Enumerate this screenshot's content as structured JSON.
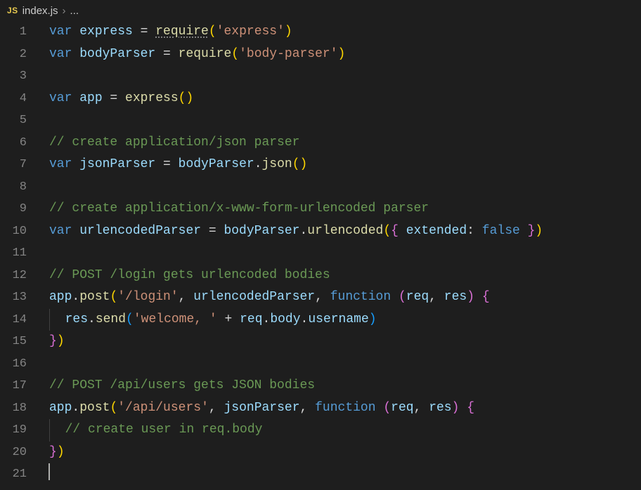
{
  "breadcrumb": {
    "icon_label": "JS",
    "filename": "index.js",
    "separator": "›",
    "path_rest": "..."
  },
  "lines": {
    "count": 21,
    "c1": [
      {
        "t": "var",
        "c": "kw"
      },
      {
        "t": " "
      },
      {
        "t": "express",
        "c": "var"
      },
      {
        "t": " = "
      },
      {
        "t": "require",
        "c": "fn",
        "hint": true
      },
      {
        "t": "(",
        "c": "brace-y"
      },
      {
        "t": "'express'",
        "c": "str"
      },
      {
        "t": ")",
        "c": "brace-y"
      }
    ],
    "c2": [
      {
        "t": "var",
        "c": "kw"
      },
      {
        "t": " "
      },
      {
        "t": "bodyParser",
        "c": "var"
      },
      {
        "t": " = "
      },
      {
        "t": "require",
        "c": "fn"
      },
      {
        "t": "(",
        "c": "brace-y"
      },
      {
        "t": "'body-parser'",
        "c": "str"
      },
      {
        "t": ")",
        "c": "brace-y"
      }
    ],
    "c3": [],
    "c4": [
      {
        "t": "var",
        "c": "kw"
      },
      {
        "t": " "
      },
      {
        "t": "app",
        "c": "var"
      },
      {
        "t": " = "
      },
      {
        "t": "express",
        "c": "fn"
      },
      {
        "t": "()",
        "c": "brace-y"
      }
    ],
    "c5": [],
    "c6": [
      {
        "t": "// create application/json parser",
        "c": "com"
      }
    ],
    "c7": [
      {
        "t": "var",
        "c": "kw"
      },
      {
        "t": " "
      },
      {
        "t": "jsonParser",
        "c": "var"
      },
      {
        "t": " = "
      },
      {
        "t": "bodyParser",
        "c": "var"
      },
      {
        "t": "."
      },
      {
        "t": "json",
        "c": "fn"
      },
      {
        "t": "()",
        "c": "brace-y"
      }
    ],
    "c8": [],
    "c9": [
      {
        "t": "// create application/x-www-form-urlencoded parser",
        "c": "com"
      }
    ],
    "c10": [
      {
        "t": "var",
        "c": "kw"
      },
      {
        "t": " "
      },
      {
        "t": "urlencodedParser",
        "c": "var"
      },
      {
        "t": " = "
      },
      {
        "t": "bodyParser",
        "c": "var"
      },
      {
        "t": "."
      },
      {
        "t": "urlencoded",
        "c": "fn"
      },
      {
        "t": "(",
        "c": "brace-y"
      },
      {
        "t": "{ ",
        "c": "brace-p"
      },
      {
        "t": "extended",
        "c": "var"
      },
      {
        "t": ":",
        "c": "pun"
      },
      {
        "t": " "
      },
      {
        "t": "false",
        "c": "bool"
      },
      {
        "t": " }",
        "c": "brace-p"
      },
      {
        "t": ")",
        "c": "brace-y"
      }
    ],
    "c11": [],
    "c12": [
      {
        "t": "// POST /login gets urlencoded bodies",
        "c": "com"
      }
    ],
    "c13": [
      {
        "t": "app",
        "c": "var"
      },
      {
        "t": "."
      },
      {
        "t": "post",
        "c": "fn"
      },
      {
        "t": "(",
        "c": "brace-y"
      },
      {
        "t": "'/login'",
        "c": "str"
      },
      {
        "t": ", "
      },
      {
        "t": "urlencodedParser",
        "c": "var"
      },
      {
        "t": ", "
      },
      {
        "t": "function",
        "c": "kw"
      },
      {
        "t": " "
      },
      {
        "t": "(",
        "c": "brace-p"
      },
      {
        "t": "req",
        "c": "var"
      },
      {
        "t": ", "
      },
      {
        "t": "res",
        "c": "var"
      },
      {
        "t": ")",
        "c": "brace-p"
      },
      {
        "t": " "
      },
      {
        "t": "{",
        "c": "brace-p"
      }
    ],
    "c14": [
      {
        "t": "  ",
        "guide": true
      },
      {
        "t": "res",
        "c": "var"
      },
      {
        "t": "."
      },
      {
        "t": "send",
        "c": "fn"
      },
      {
        "t": "(",
        "c": "brace-b"
      },
      {
        "t": "'welcome, '",
        "c": "str"
      },
      {
        "t": " + "
      },
      {
        "t": "req",
        "c": "var"
      },
      {
        "t": "."
      },
      {
        "t": "body",
        "c": "var"
      },
      {
        "t": "."
      },
      {
        "t": "username",
        "c": "var"
      },
      {
        "t": ")",
        "c": "brace-b"
      }
    ],
    "c15": [
      {
        "t": "}",
        "c": "brace-p"
      },
      {
        "t": ")",
        "c": "brace-y"
      }
    ],
    "c16": [],
    "c17": [
      {
        "t": "// POST /api/users gets JSON bodies",
        "c": "com"
      }
    ],
    "c18": [
      {
        "t": "app",
        "c": "var"
      },
      {
        "t": "."
      },
      {
        "t": "post",
        "c": "fn"
      },
      {
        "t": "(",
        "c": "brace-y"
      },
      {
        "t": "'/api/users'",
        "c": "str"
      },
      {
        "t": ", "
      },
      {
        "t": "jsonParser",
        "c": "var"
      },
      {
        "t": ", "
      },
      {
        "t": "function",
        "c": "kw"
      },
      {
        "t": " "
      },
      {
        "t": "(",
        "c": "brace-p"
      },
      {
        "t": "req",
        "c": "var"
      },
      {
        "t": ", "
      },
      {
        "t": "res",
        "c": "var"
      },
      {
        "t": ")",
        "c": "brace-p"
      },
      {
        "t": " "
      },
      {
        "t": "{",
        "c": "brace-p"
      }
    ],
    "c19": [
      {
        "t": "  ",
        "guide": true
      },
      {
        "t": "// create user in req.body",
        "c": "com"
      }
    ],
    "c20": [
      {
        "t": "}",
        "c": "brace-p"
      },
      {
        "t": ")",
        "c": "brace-y"
      }
    ],
    "c21": [
      {
        "cursor": true
      }
    ]
  }
}
